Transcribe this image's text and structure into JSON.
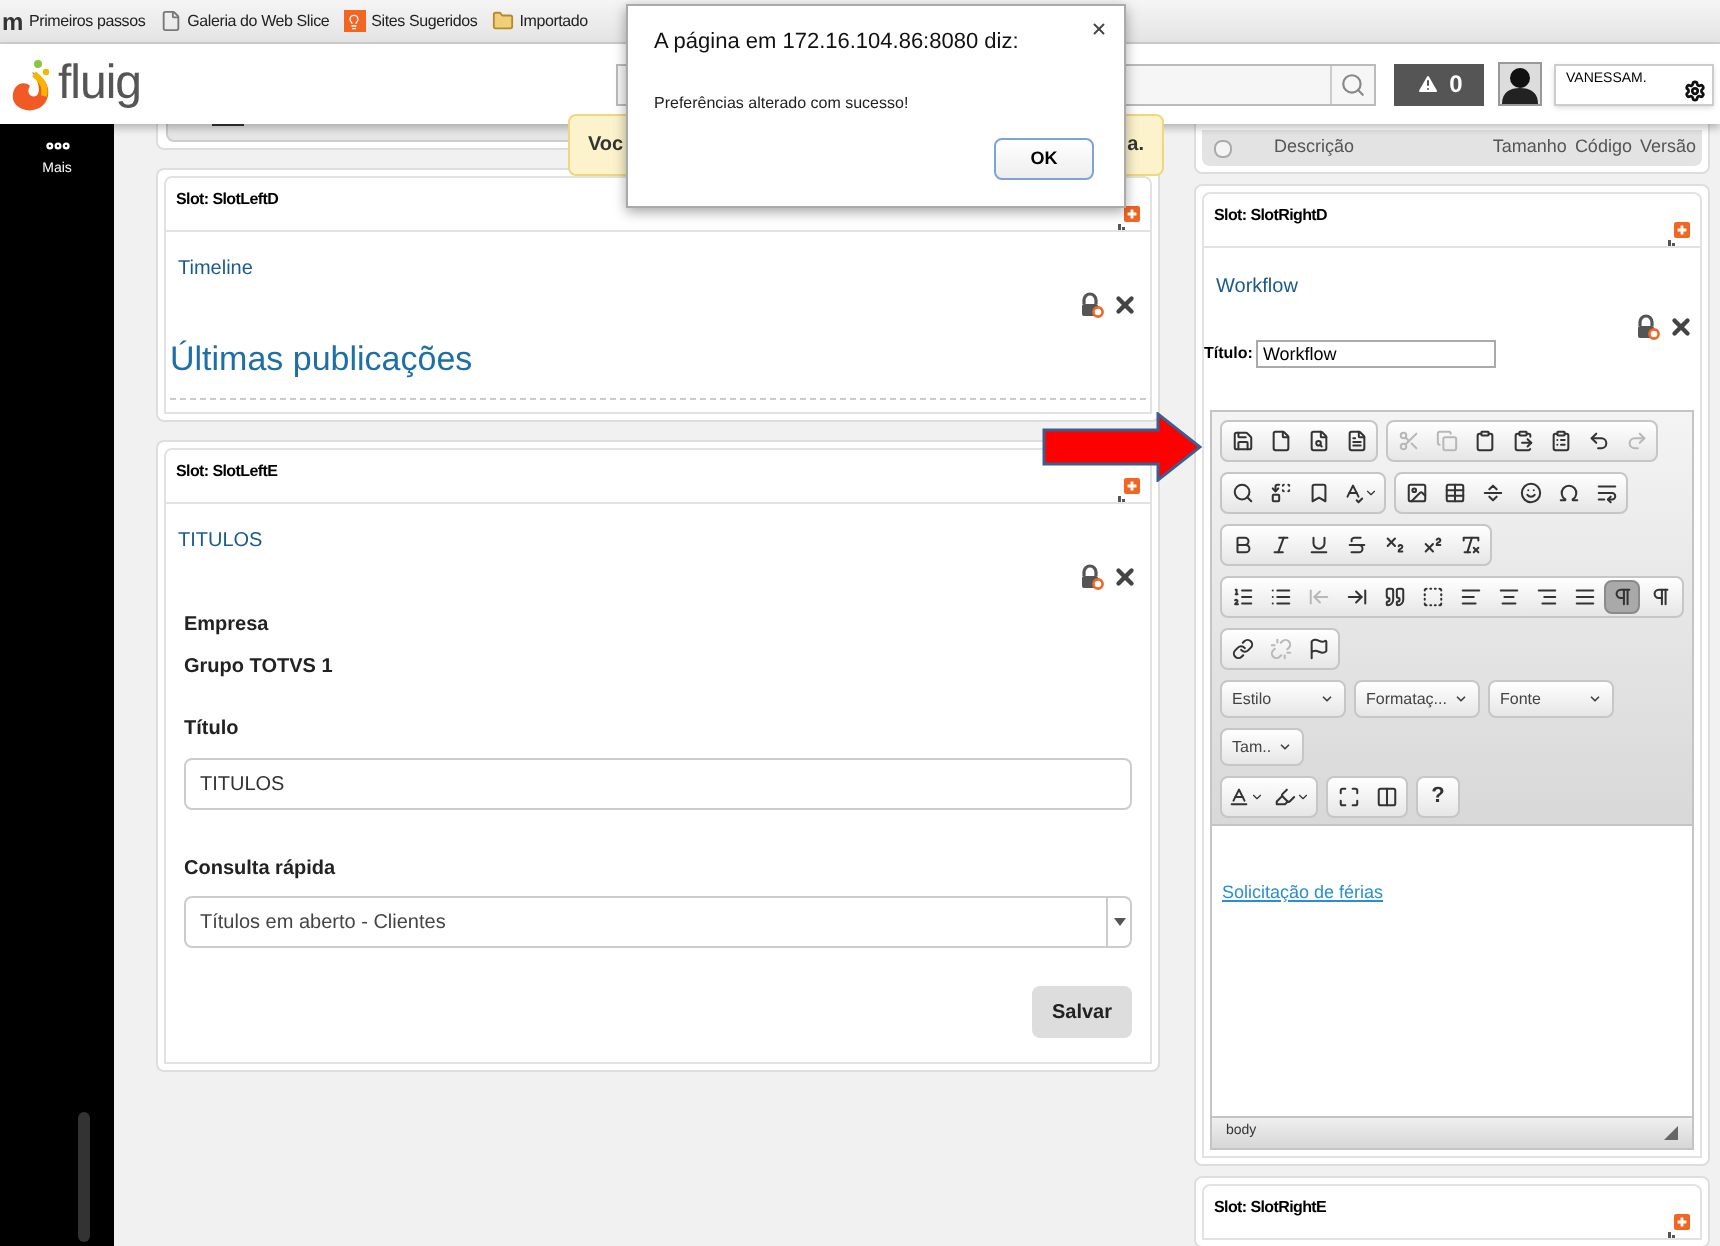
{
  "bookmarks": [
    {
      "kind": "letter",
      "icon_text": "m",
      "label": "Primeiros passos"
    },
    {
      "kind": "page",
      "label": "Galeria do Web Slice"
    },
    {
      "kind": "bulb",
      "label": "Sites Sugeridos"
    },
    {
      "kind": "folder",
      "label": "Importado"
    }
  ],
  "header": {
    "logo_text": "fluig",
    "alerts": {
      "count": "0"
    },
    "user": {
      "name": "VANESSAM."
    }
  },
  "sidebar": {
    "items": [
      {
        "label": "Mais"
      }
    ]
  },
  "notice": {
    "text_start": "Voc",
    "text_end": "a."
  },
  "documents_table": {
    "select_all": {
      "checked": false
    },
    "columns": [
      "Descrição",
      "Tamanho",
      "Código",
      "Versão"
    ]
  },
  "left_slots": [
    {
      "slot": "Slot: SlotLeftD",
      "kind": "timeline",
      "widget_title": "Timeline",
      "heading": "Últimas publicações"
    },
    {
      "slot": "Slot: SlotLeftE",
      "kind": "form",
      "widget_title": "TITULOS",
      "company_label": "Empresa",
      "company": "Grupo TOTVS 1",
      "title_label": "Título",
      "title_value": "TITULOS",
      "query_label": "Consulta rápida",
      "query_value": "Títulos em aberto - Clientes",
      "save": "Salvar"
    }
  ],
  "right_slots": [
    {
      "slot": "Slot: SlotRightD",
      "kind": "editor",
      "widget_title": "Workflow",
      "title_label": "Título:",
      "title_value": "Workflow",
      "editor": {
        "rows": [
          {
            "kind": "buttons",
            "groups": [
              [
                {
                  "kind": "save",
                  "disabled": false,
                  "on": false
                },
                {
                  "kind": "new-page",
                  "disabled": false,
                  "on": false
                },
                {
                  "kind": "preview",
                  "disabled": false,
                  "on": false
                },
                {
                  "kind": "templates",
                  "disabled": false,
                  "on": false
                }
              ],
              [
                {
                  "kind": "cut",
                  "disabled": true,
                  "on": false
                },
                {
                  "kind": "copy",
                  "disabled": true,
                  "on": false
                },
                {
                  "kind": "paste",
                  "disabled": false,
                  "on": false
                },
                {
                  "kind": "paste-text",
                  "disabled": false,
                  "on": false
                },
                {
                  "kind": "paste-word",
                  "disabled": false,
                  "on": false
                },
                {
                  "kind": "undo",
                  "disabled": false,
                  "on": false
                },
                {
                  "kind": "redo",
                  "disabled": true,
                  "on": false
                }
              ]
            ]
          },
          {
            "kind": "buttons",
            "groups": [
              [
                {
                  "kind": "find",
                  "disabled": false,
                  "on": false
                },
                {
                  "kind": "replace",
                  "disabled": false,
                  "on": false
                },
                {
                  "kind": "select-all",
                  "disabled": false,
                  "on": false
                },
                {
                  "kind": "spellcheck",
                  "disabled": false,
                  "on": false
                }
              ],
              [
                {
                  "kind": "image",
                  "disabled": false,
                  "on": false
                },
                {
                  "kind": "table",
                  "disabled": false,
                  "on": false
                },
                {
                  "kind": "rule",
                  "disabled": false,
                  "on": false
                },
                {
                  "kind": "smiley",
                  "disabled": false,
                  "on": false
                },
                {
                  "kind": "special-char",
                  "disabled": false,
                  "on": false
                },
                {
                  "kind": "page-break",
                  "disabled": false,
                  "on": false
                }
              ]
            ]
          },
          {
            "kind": "buttons",
            "groups": [
              [
                {
                  "kind": "bold",
                  "disabled": false,
                  "on": false
                },
                {
                  "kind": "italic",
                  "disabled": false,
                  "on": false
                },
                {
                  "kind": "underline",
                  "disabled": false,
                  "on": false
                },
                {
                  "kind": "strike",
                  "disabled": false,
                  "on": false
                },
                {
                  "kind": "subscript",
                  "disabled": false,
                  "on": false
                },
                {
                  "kind": "superscript",
                  "disabled": false,
                  "on": false
                },
                {
                  "kind": "remove-format",
                  "disabled": false,
                  "on": false
                }
              ]
            ]
          },
          {
            "kind": "buttons",
            "groups": [
              [
                {
                  "kind": "ordered-list",
                  "disabled": false,
                  "on": false
                },
                {
                  "kind": "bullet-list",
                  "disabled": false,
                  "on": false
                },
                {
                  "kind": "outdent",
                  "disabled": true,
                  "on": false
                },
                {
                  "kind": "indent",
                  "disabled": false,
                  "on": false
                },
                {
                  "kind": "blockquote",
                  "disabled": false,
                  "on": false
                },
                {
                  "kind": "div",
                  "disabled": false,
                  "on": false
                },
                {
                  "kind": "align-left",
                  "disabled": false,
                  "on": false
                },
                {
                  "kind": "align-center",
                  "disabled": false,
                  "on": false
                },
                {
                  "kind": "align-right",
                  "disabled": false,
                  "on": false
                },
                {
                  "kind": "justify",
                  "disabled": false,
                  "on": false
                },
                {
                  "kind": "ltr",
                  "disabled": false,
                  "on": true
                },
                {
                  "kind": "rtl",
                  "disabled": false,
                  "on": false
                }
              ]
            ]
          },
          {
            "kind": "buttons",
            "groups": [
              [
                {
                  "kind": "link",
                  "disabled": false,
                  "on": false
                },
                {
                  "kind": "unlink",
                  "disabled": true,
                  "on": false
                },
                {
                  "kind": "anchor",
                  "disabled": false,
                  "on": false
                }
              ]
            ]
          },
          {
            "kind": "dropdowns",
            "items": [
              "Estilo",
              "Formataç...",
              "Fonte",
              "Tam.."
            ]
          },
          {
            "kind": "buttons",
            "groups": [
              [
                {
                  "kind": "text-color",
                  "disabled": false,
                  "on": false
                },
                {
                  "kind": "bg-color",
                  "disabled": false,
                  "on": false
                }
              ],
              [
                {
                  "kind": "maximize",
                  "disabled": false,
                  "on": false
                },
                {
                  "kind": "show-blocks",
                  "disabled": false,
                  "on": false
                }
              ],
              [
                {
                  "kind": "help",
                  "label": "?",
                  "disabled": false,
                  "on": false
                }
              ]
            ]
          }
        ],
        "content_link": "Solicitação de férias",
        "path": "body"
      }
    },
    {
      "slot": "Slot: SlotRightE",
      "kind": "empty"
    }
  ],
  "dialog": {
    "title": "A página em 172.16.104.86:8080 diz:",
    "message": "Preferências alterado com sucesso!",
    "ok": "OK"
  }
}
